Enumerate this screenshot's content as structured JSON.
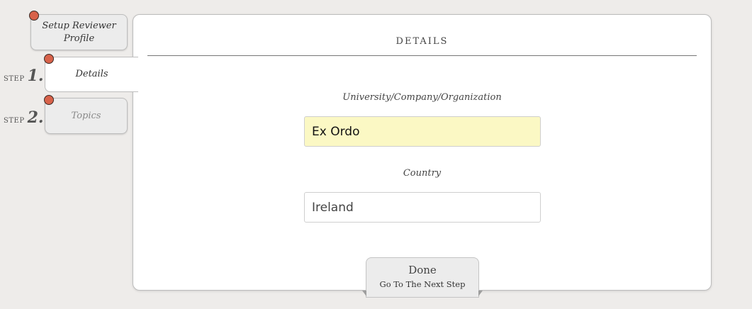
{
  "sidebar": {
    "setup_tab": {
      "label": "Setup Reviewer Profile"
    },
    "steps": [
      {
        "step_word": "STEP",
        "number": "1.",
        "label": "Details",
        "active": true
      },
      {
        "step_word": "STEP",
        "number": "2.",
        "label": "Topics",
        "active": false
      }
    ],
    "status_dot_color": "#d8624a"
  },
  "panel": {
    "title": "DETAILS",
    "fields": {
      "organization": {
        "label": "University/Company/Organization",
        "value": "Ex Ordo",
        "highlight_color": "#fbf8c4"
      },
      "country": {
        "label": "Country",
        "value": "Ireland"
      }
    }
  },
  "done_button": {
    "title": "Done",
    "subtitle": "Go To The Next Step"
  }
}
